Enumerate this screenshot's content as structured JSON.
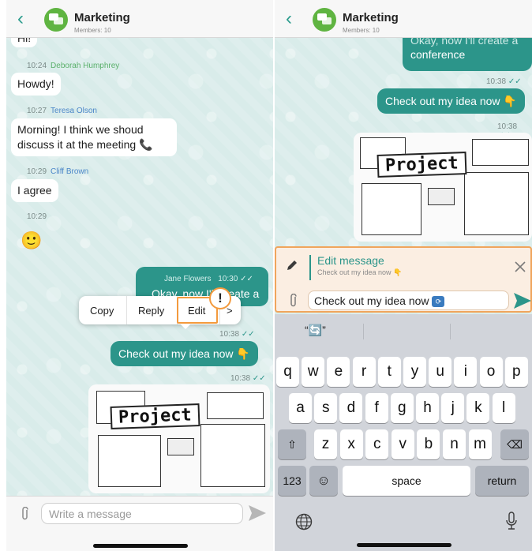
{
  "left": {
    "header": {
      "title": "Marketing",
      "subtitle": "Members: 10"
    },
    "partial_top": "Hi!",
    "messages": [
      {
        "time": "10:24",
        "author": "Deborah Humphrey",
        "text": "Howdy!"
      },
      {
        "time": "10:27",
        "author": "Teresa Olson",
        "line1": "Morning! I think we shoud",
        "line2": "discuss it at the meeting 📞"
      },
      {
        "time": "10:29",
        "author": "Cliff Brown",
        "text": "I agree"
      },
      {
        "time": "10:29",
        "emoji": "🙂"
      }
    ],
    "own": {
      "author": "Jane Flowers",
      "time1": "10:30",
      "text1": "Okay, now I'll create a",
      "time2": "10:38",
      "text2": "Check out my idea now 👇",
      "time3": "10:38"
    },
    "context_menu": {
      "copy": "Copy",
      "reply": "Reply",
      "edit": "Edit",
      "more": ">"
    },
    "alert_mark": "!",
    "sketch_label": "Project",
    "input": {
      "placeholder": "Write a message"
    }
  },
  "right": {
    "header": {
      "title": "Marketing",
      "subtitle": "Members: 10"
    },
    "own": {
      "top_line1": "Okay, now I'll create a",
      "top_line2": "conference",
      "time1": "10:38",
      "text": "Check out my idea now 👇",
      "time2": "10:38"
    },
    "sketch_label": "Project",
    "edit": {
      "title": "Edit message",
      "subtitle": "Check out my idea now 👇",
      "value": "Check out my idea now"
    },
    "keyboard": {
      "suggestion": "“🔄”",
      "row1": [
        "q",
        "w",
        "e",
        "r",
        "t",
        "y",
        "u",
        "i",
        "o",
        "p"
      ],
      "row2": [
        "a",
        "s",
        "d",
        "f",
        "g",
        "h",
        "j",
        "k",
        "l"
      ],
      "row3": [
        "z",
        "x",
        "c",
        "v",
        "b",
        "n",
        "m"
      ],
      "numbers": "123",
      "space": "space",
      "return": "return"
    }
  },
  "colors": {
    "accent": "#2c958a",
    "highlight": "#f39a3d",
    "avatar": "#5fb441"
  }
}
